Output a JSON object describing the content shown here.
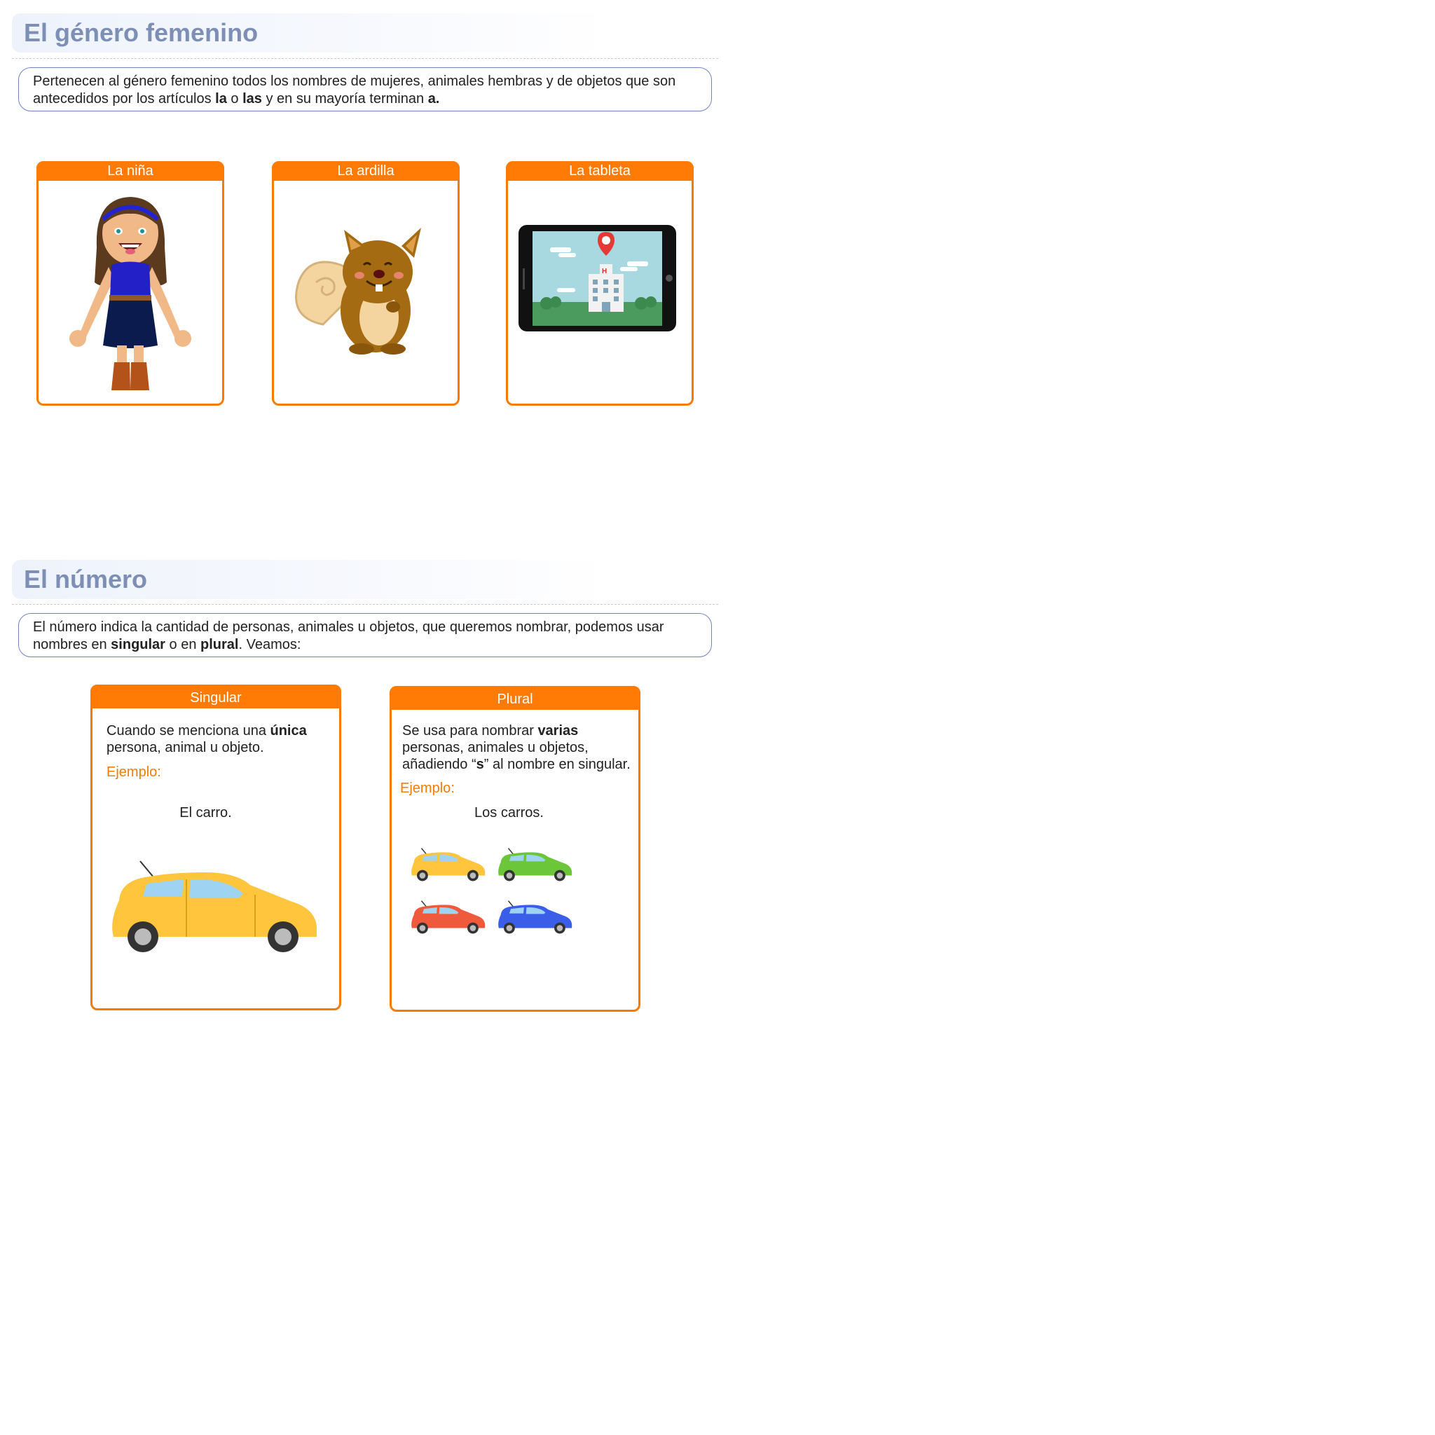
{
  "section1": {
    "title": "El género femenino",
    "intro": {
      "part1": "Pertenecen al género femenino todos los nombres de mujeres, animales hembras y de objetos que son antecedidos por los artículos ",
      "bold1": "la",
      "part2": " o ",
      "bold2": "las",
      "part3": " y en su mayoría terminan ",
      "bold3": "a."
    },
    "cards": [
      {
        "label": "La niña",
        "icon": "girl-illustration"
      },
      {
        "label": "La ardilla",
        "icon": "squirrel-illustration"
      },
      {
        "label": "La tableta",
        "icon": "tablet-illustration"
      }
    ]
  },
  "section2": {
    "title": "El número",
    "intro": {
      "part1": "El número indica la cantidad de personas, animales u objetos, que queremos nombrar, podemos usar nombres en  ",
      "bold1": "singular",
      "part2": " o en ",
      "bold2": "plural",
      "part3": ". Veamos:"
    },
    "singular": {
      "label": "Singular",
      "text1": "Cuando se menciona una ",
      "bold": "única",
      "text2": " persona, animal u objeto.",
      "example_label": "Ejemplo:",
      "example": "El carro.",
      "car_color": "#ffc53d"
    },
    "plural": {
      "label": "Plural",
      "text1": "Se usa para nombrar ",
      "bold1": "varias",
      "text2": " personas, animales u objetos, añadiendo “",
      "bold2": "s",
      "text3": "” al nombre en singular.",
      "example_label": "Ejemplo:",
      "example": "Los carros.",
      "car_colors": [
        "#ffc53d",
        "#6cc63a",
        "#f05a3c",
        "#3b5ee8"
      ]
    }
  },
  "colors": {
    "accent": "#ff7b05",
    "title": "#7d8fb4",
    "intro_border": "#6f83c2"
  }
}
